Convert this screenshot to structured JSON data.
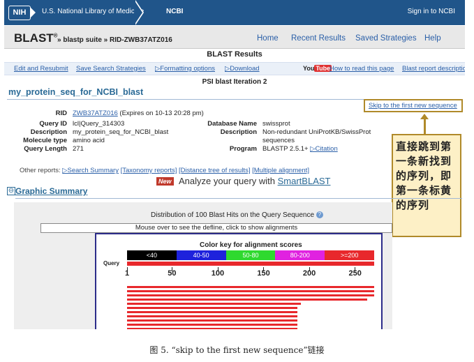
{
  "nih": {
    "logo": "NIH",
    "org": "U.S. National Library of Medicine",
    "ncbi": "NCBI",
    "signin": "Sign in to NCBI"
  },
  "blast": {
    "logo": "BLAST",
    "reg": "®",
    "breadcrumb": "» blastp suite » RID-ZWB37ATZ016",
    "nav": [
      "Home",
      "Recent Results",
      "Saved Strategies",
      "Help"
    ]
  },
  "results_title": "BLAST Results",
  "linkbar": {
    "edit": "Edit and Resubmit",
    "save": "Save Search Strategies",
    "formatting": "▷Formatting options",
    "download": "▷Download",
    "youtube_you": "You",
    "youtube_tube": "Tube",
    "howto": "How to read this page",
    "report": "Blast report description"
  },
  "iteration": "PSI blast Iteration 2",
  "seq_name": "my_protein_seq_for_NCBI_blast",
  "skip_link": "Skip to the first new sequence",
  "info": {
    "rid_label": "RID",
    "rid_value": "ZWB37ATZ016",
    "rid_expires": "(Expires on 10-13 20:28 pm)",
    "query_id_label": "Query ID",
    "query_id": "lcl|Query_314303",
    "description_label": "Description",
    "description": "my_protein_seq_for_NCBI_blast",
    "moltype_label": "Molecule type",
    "moltype": "amino acid",
    "qlen_label": "Query Length",
    "qlen": "271",
    "db_label": "Database Name",
    "db": "swissprot",
    "db_desc_label": "Description",
    "db_desc_1": "Non-redundant UniProtKB/SwissProt",
    "db_desc_2": "sequences",
    "program_label": "Program",
    "program": "BLASTP 2.5.1+",
    "citation": "▷Citation"
  },
  "annotation": "直接跳到第一条新找到的序列，即第一条标黄的序列",
  "other_reports": {
    "label": "Other reports:",
    "links": [
      "▷Search Summary",
      "[Taxonomy reports]",
      "[Distance tree of results]",
      "[Multiple alignment]"
    ]
  },
  "smartblast": {
    "badge": "New",
    "text": "Analyze your query with ",
    "link": "SmartBLAST"
  },
  "graphic_summary": {
    "toggle": "⊖",
    "title": "Graphic Summary",
    "distribution": "Distribution of 100 Blast Hits on the Query Sequence",
    "help": "?",
    "mouseover": "Mouse over to see the defline, click to show alignments",
    "color_key_title": "Color key for alignment scores",
    "color_key": [
      {
        "label": "<40",
        "color": "#000000"
      },
      {
        "label": "40-50",
        "color": "#1e22dc"
      },
      {
        "label": "50-80",
        "color": "#2fd92f"
      },
      {
        "label": "80-200",
        "color": "#e022e0"
      },
      {
        "label": ">=200",
        "color": "#e8282c"
      }
    ],
    "query_label": "Query",
    "ticks": [
      "1",
      "50",
      "100",
      "150",
      "200",
      "250"
    ]
  },
  "caption": "图 5.  “skip to the first new sequence”链接"
}
